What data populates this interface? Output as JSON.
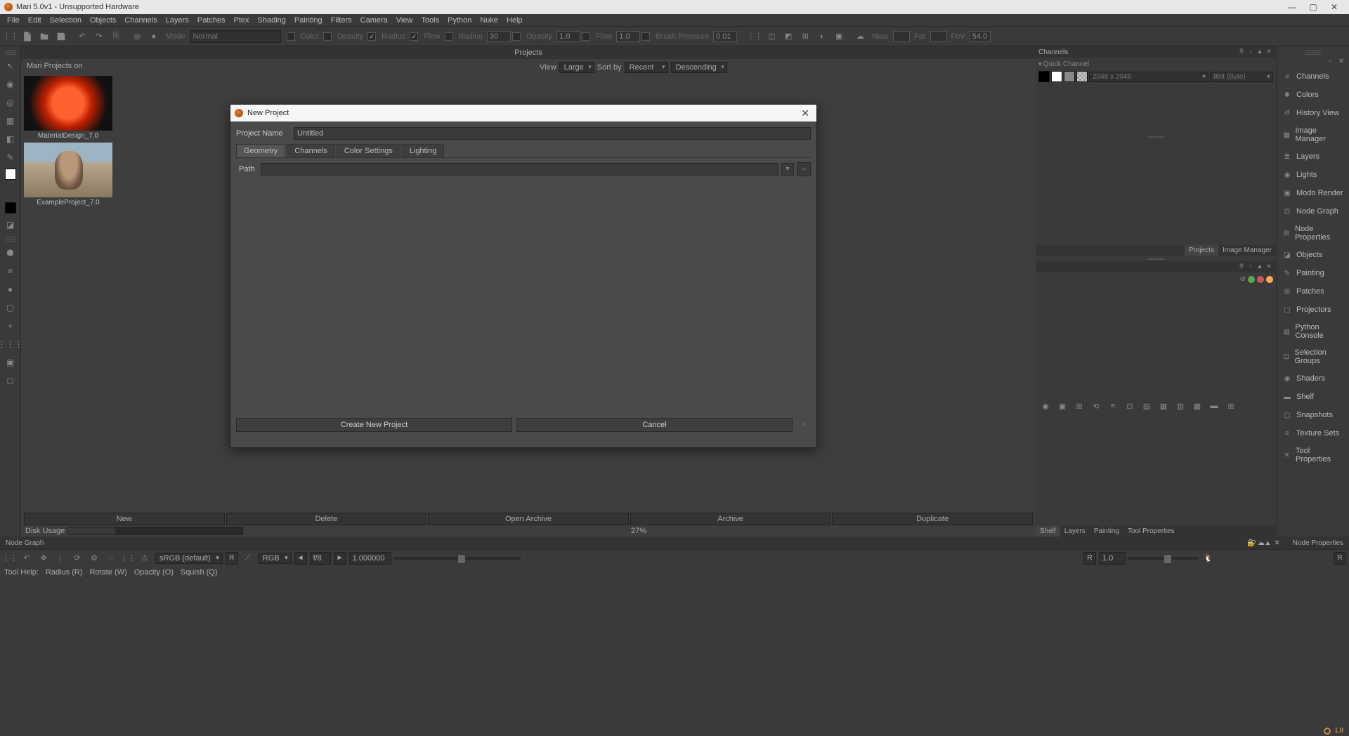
{
  "window": {
    "title": "Mari 5.0v1 - Unsupported Hardware"
  },
  "menus": [
    "File",
    "Edit",
    "Selection",
    "Objects",
    "Channels",
    "Layers",
    "Patches",
    "Ptex",
    "Shading",
    "Painting",
    "Filters",
    "Camera",
    "View",
    "Tools",
    "Python",
    "Nuke",
    "Help"
  ],
  "toolbar": {
    "mode_label": "Mode",
    "mode_value": "Normal",
    "color_label": "Color",
    "opacity_label": "Opacity",
    "radius_label": "Radius",
    "flow_label": "Flow",
    "radius2_label": "Radius",
    "radius2_value": "30",
    "opacity2_label": "Opacity",
    "opacity2_value": "1.0",
    "flow2_label": "Flow",
    "flow2_value": "1.0",
    "brush_label": "Brush Pressure",
    "brush_value": "0.01",
    "near_label": "Near",
    "near_value": "",
    "far_label": "Far",
    "far_value": "",
    "fov_label": "FoV",
    "fov_value": "54.0"
  },
  "projects": {
    "header": "Projects",
    "sub": "Mari Projects on",
    "view": "View",
    "view_val": "Large",
    "sort": "Sort by",
    "sort_val": "Recent",
    "order": "Descending",
    "items": [
      {
        "name": "MaterialDesign_7.0"
      },
      {
        "name": "ExampleProject_7.0"
      }
    ],
    "buttons": [
      "New",
      "Delete",
      "Open Archive",
      "Archive",
      "Duplicate"
    ],
    "disk_label": "Disk Usage",
    "disk_pct": "27%"
  },
  "channels": {
    "title": "Channels",
    "quick": "Quick Channel",
    "size": "2048 x 2048",
    "depth": "8bit (Byte)"
  },
  "rightTabs1": [
    "Projects",
    "Image Manager"
  ],
  "rightIconsActive": "Projects",
  "bottomTabs": [
    "Shelf",
    "Layers",
    "Painting",
    "Tool Properties"
  ],
  "bottomTabsActive": "Shelf",
  "node_graph": "Node Graph",
  "node_props": "Node Properties",
  "rightPanels": [
    "Channels",
    "Colors",
    "History View",
    "Image Manager",
    "Layers",
    "Lights",
    "Modo Render",
    "Node Graph",
    "Node Properties",
    "Objects",
    "Painting",
    "Patches",
    "Projectors",
    "Python Console",
    "Selection Groups",
    "Shaders",
    "Shelf",
    "Snapshots",
    "Texture Sets",
    "Tool Properties"
  ],
  "status": {
    "colorspace": "sRGB (default)",
    "r": "R",
    "channel": "RGB",
    "fstop": "f/8",
    "exposure": "1.000000",
    "scale": "1.0"
  },
  "help": {
    "label": "Tool Help:",
    "keys": [
      "Radius (R)",
      "Rotate (W)",
      "Opacity (O)",
      "Squish (Q)"
    ]
  },
  "dialog": {
    "title": "New Project",
    "name_label": "Project Name",
    "name_value": "Untitled",
    "tabs": [
      "Geometry",
      "Channels",
      "Color Settings",
      "Lighting"
    ],
    "path_label": "Path",
    "create": "Create New Project",
    "cancel": "Cancel"
  }
}
